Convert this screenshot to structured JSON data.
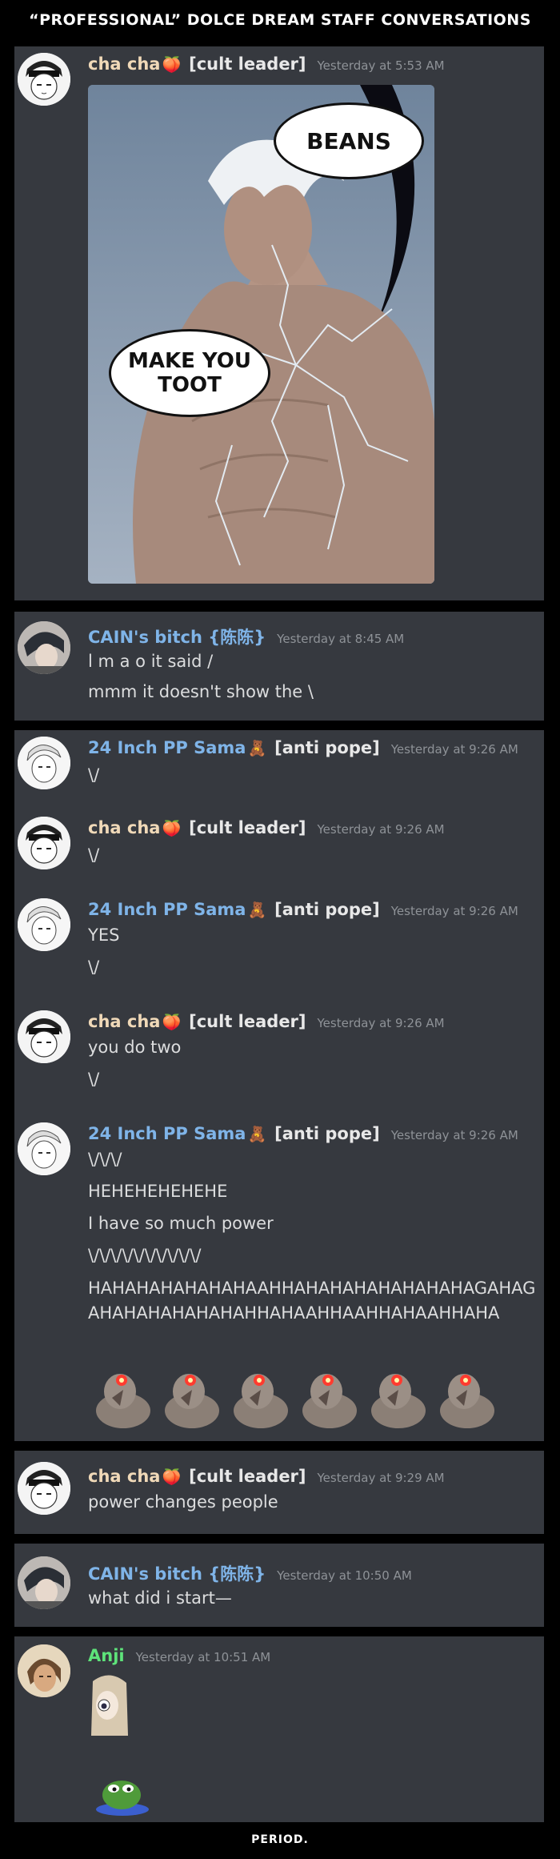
{
  "title": "“PROFESSIONAL” DOLCE DREAM STAFF CONVERSATIONS",
  "footer": "PERIOD.",
  "comic": {
    "bubble_top": "BEANS",
    "bubble_bottom_line1": "MAKE YOU",
    "bubble_bottom_line2": "TOOT"
  },
  "users": {
    "cha": {
      "name": "cha cha",
      "role": "[cult leader]"
    },
    "cain": {
      "name": "CAIN's bitch {陈陈}"
    },
    "pp": {
      "name": "24 Inch PP Sama",
      "role": "[anti pope]"
    },
    "anji": {
      "name": "Anji"
    }
  },
  "messages": {
    "m1": {
      "time": "Yesterday at 5:53 AM"
    },
    "m2": {
      "time": "Yesterday at 8:45 AM",
      "lines": [
        "l m a o it said /",
        "mmm it doesn't show the \\"
      ]
    },
    "m3a": {
      "time": "Yesterday at 9:26 AM",
      "lines": [
        "\\/"
      ]
    },
    "m3b": {
      "time": "Yesterday at 9:26 AM",
      "lines": [
        "\\/"
      ]
    },
    "m3c": {
      "time": "Yesterday at 9:26 AM",
      "lines": [
        "YES",
        "\\/"
      ]
    },
    "m3d": {
      "time": "Yesterday at 9:26 AM",
      "lines": [
        "you do two",
        "\\/"
      ]
    },
    "m3e": {
      "time": "Yesterday at 9:26 AM",
      "lines": [
        "\\/\\/\\/",
        "HEHEHEHEHEHE",
        "I have so much power",
        "\\/\\/\\/\\/\\/\\/\\/\\/\\/\\/",
        "HAHAHAHAHAHAHAAHHAHAHAHAHAHAHAHAGAHAGAHAHAHAHAHAHAHHAHAAHHAAHHAHAAHHAHA"
      ]
    },
    "m4": {
      "time": "Yesterday at 9:29 AM",
      "lines": [
        "power changes people"
      ]
    },
    "m5": {
      "time": "Yesterday at 10:50 AM",
      "lines": [
        "what did i start—"
      ]
    },
    "m6": {
      "time": "Yesterday at 10:51 AM"
    }
  },
  "colors": {
    "bg": "#000000",
    "panel": "#36393f",
    "text": "#dcddde",
    "timestamp": "#8e9297",
    "link_name": "#7fb4e8",
    "anji_name": "#5ee37a"
  }
}
